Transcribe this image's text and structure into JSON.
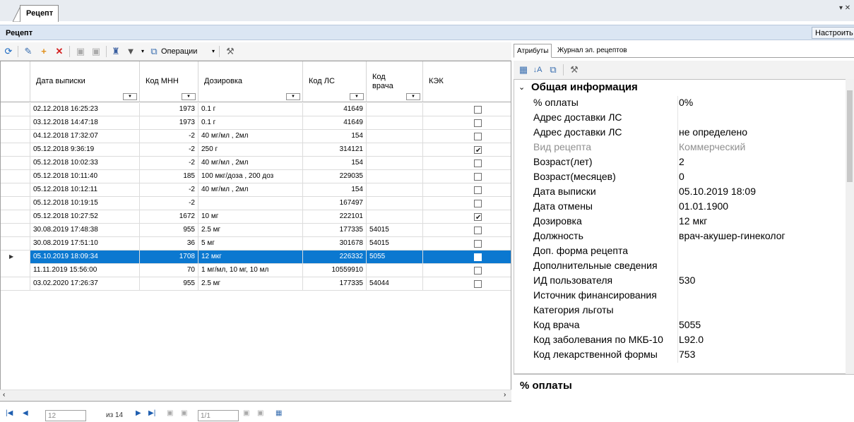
{
  "doc_tab": {
    "label": "Рецепт"
  },
  "header": {
    "title": "Рецепт",
    "customize_label": "Настроить"
  },
  "toolbar": {
    "operations_label": "Операции"
  },
  "grid": {
    "columns": [
      "Дата выписки",
      "Код МНН",
      "Дозировка",
      "Код ЛС",
      "Код врача",
      "КЭК"
    ],
    "rows": [
      {
        "date": "02.12.2018 16:25:23",
        "mnn": "1973",
        "dose": "0.1 г",
        "ls": "41649",
        "doctor": "",
        "kek": false
      },
      {
        "date": "03.12.2018 14:47:18",
        "mnn": "1973",
        "dose": "0.1 г",
        "ls": "41649",
        "doctor": "",
        "kek": false
      },
      {
        "date": "04.12.2018 17:32:07",
        "mnn": "-2",
        "dose": "40 мг/мл , 2мл",
        "ls": "154",
        "doctor": "",
        "kek": false
      },
      {
        "date": "05.12.2018 9:36:19",
        "mnn": "-2",
        "dose": "250 г",
        "ls": "314121",
        "doctor": "",
        "kek": true
      },
      {
        "date": "05.12.2018 10:02:33",
        "mnn": "-2",
        "dose": "40 мг/мл , 2мл",
        "ls": "154",
        "doctor": "",
        "kek": false
      },
      {
        "date": "05.12.2018 10:11:40",
        "mnn": "185",
        "dose": "100 мкг/доза , 200 доз",
        "ls": "229035",
        "doctor": "",
        "kek": false
      },
      {
        "date": "05.12.2018 10:12:11",
        "mnn": "-2",
        "dose": "40 мг/мл , 2мл",
        "ls": "154",
        "doctor": "",
        "kek": false
      },
      {
        "date": "05.12.2018 10:19:15",
        "mnn": "-2",
        "dose": "",
        "ls": "167497",
        "doctor": "",
        "kek": false
      },
      {
        "date": "05.12.2018 10:27:52",
        "mnn": "1672",
        "dose": "10 мг",
        "ls": "222101",
        "doctor": "",
        "kek": true
      },
      {
        "date": "30.08.2019 17:48:38",
        "mnn": "955",
        "dose": "2.5 мг",
        "ls": "177335",
        "doctor": "54015",
        "kek": false
      },
      {
        "date": "30.08.2019 17:51:10",
        "mnn": "36",
        "dose": "5 мг",
        "ls": "301678",
        "doctor": "54015",
        "kek": false
      },
      {
        "date": "05.10.2019 18:09:34",
        "mnn": "1708",
        "dose": "12 мкг",
        "ls": "226332",
        "doctor": "5055",
        "kek": false,
        "selected": true
      },
      {
        "date": "11.11.2019 15:56:00",
        "mnn": "70",
        "dose": "1 мг/мл, 10 мг, 10 мл",
        "ls": "10559910",
        "doctor": "",
        "kek": false
      },
      {
        "date": "03.02.2020 17:26:37",
        "mnn": "955",
        "dose": "2.5 мг",
        "ls": "177335",
        "doctor": "54044",
        "kek": false
      }
    ]
  },
  "pager": {
    "current": "12",
    "of_label": "из 14",
    "page": "1/1"
  },
  "right_panel": {
    "tabs": [
      "Атрибуты",
      "Журнал эл. рецептов"
    ],
    "category": "Общая информация",
    "properties": [
      {
        "name": "% оплаты",
        "value": "0%"
      },
      {
        "name": "Адрес доставки ЛС",
        "value": ""
      },
      {
        "name": "Адрес доставки ЛС",
        "value": "не определено"
      },
      {
        "name": "Вид рецепта",
        "value": "Коммерческий",
        "disabled": true
      },
      {
        "name": "Возраст(лет)",
        "value": "2"
      },
      {
        "name": "Возраст(месяцев)",
        "value": "0"
      },
      {
        "name": "Дата выписки",
        "value": "05.10.2019 18:09"
      },
      {
        "name": "Дата отмены",
        "value": "01.01.1900"
      },
      {
        "name": "Дозировка",
        "value": "12 мкг"
      },
      {
        "name": "Должность",
        "value": "врач-акушер-гинеколог"
      },
      {
        "name": "Доп. форма рецепта",
        "value": ""
      },
      {
        "name": "Дополнительные сведения",
        "value": ""
      },
      {
        "name": "ИД пользователя",
        "value": "530"
      },
      {
        "name": "Источник финансирования",
        "value": ""
      },
      {
        "name": "Категория льготы",
        "value": ""
      },
      {
        "name": "Код врача",
        "value": "5055"
      },
      {
        "name": "Код заболевания по МКБ-10",
        "value": "L92.0"
      },
      {
        "name": "Код лекарственной формы",
        "value": "753"
      }
    ],
    "description_title": "% оплаты"
  },
  "colors": {
    "selection": "#0b78d0",
    "header_bg": "#dbe6f3",
    "accent_blue": "#1f5fb0"
  }
}
